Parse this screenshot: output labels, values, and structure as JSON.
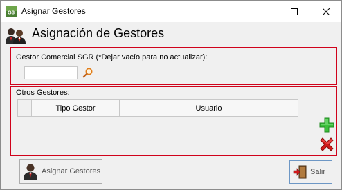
{
  "window": {
    "title": "Asignar Gestores",
    "app_icon_text": "G3"
  },
  "header": {
    "title": "Asignación de Gestores"
  },
  "commercial": {
    "label": "Gestor Comercial SGR (*Dejar vacío para no actualizar):",
    "input_value": "",
    "input_placeholder": ""
  },
  "others": {
    "label": "Otros Gestores:",
    "columns": [
      "Tipo Gestor",
      "Usuario"
    ],
    "rows": []
  },
  "actions": {
    "assign_label": "Asignar Gestores",
    "exit_label": "Salir"
  },
  "colors": {
    "group_border": "#d0021b",
    "add_icon": "#2fb52f",
    "delete_icon": "#d21a1a"
  }
}
